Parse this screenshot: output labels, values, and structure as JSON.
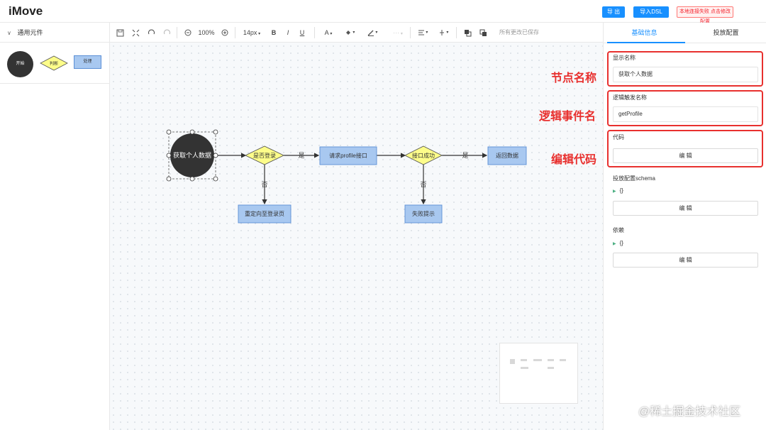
{
  "header": {
    "app_title": "iMove",
    "export_label": "导 出",
    "import_label": "导入DSL",
    "connection_status": "本地连接失败 点击修改配置"
  },
  "sidebar": {
    "section_label": "通用元件",
    "components": [
      {
        "name": "start",
        "label": "开始"
      },
      {
        "name": "judge",
        "label": "判断"
      },
      {
        "name": "process",
        "label": "处理"
      }
    ]
  },
  "toolbar": {
    "zoom_level": "100%",
    "font_size": "14px",
    "bold": "B",
    "italic": "I",
    "underline": "U",
    "save_status": "所有更改已保存"
  },
  "flow": {
    "nodes": {
      "start": "获取个人数据",
      "is_logged_in": "是否登录",
      "request_profile": "请求profile接口",
      "api_success": "接口成功",
      "return_data": "返回数据",
      "redirect_login": "重定向至登录页",
      "fail_tip": "失败提示"
    },
    "edge_labels": {
      "yes1": "是",
      "yes2": "是",
      "no1": "否",
      "no2": "否"
    }
  },
  "right_panel": {
    "tabs": [
      "基础信息",
      "投放配置"
    ],
    "active_tab": "基础信息",
    "display_name_label": "显示名称",
    "display_name_value": "获取个人数据",
    "trigger_name_label": "逻辑触发名称",
    "trigger_name_value": "getProfile",
    "code_label": "代码",
    "edit_label": "编 辑",
    "schema_label": "投放配置schema",
    "schema_value": "{}",
    "deps_label": "依赖",
    "deps_value": "{}"
  },
  "annotations": {
    "node_name": "节点名称",
    "logic_event_name": "逻辑事件名",
    "edit_code": "编辑代码"
  },
  "watermark": "@稀土掘金技术社区",
  "colors": {
    "accent": "#1890ff",
    "highlight": "#e8302e",
    "node_fill": "#a8c8f0",
    "diamond_fill": "#fdfd8a",
    "start_fill": "#333333"
  }
}
